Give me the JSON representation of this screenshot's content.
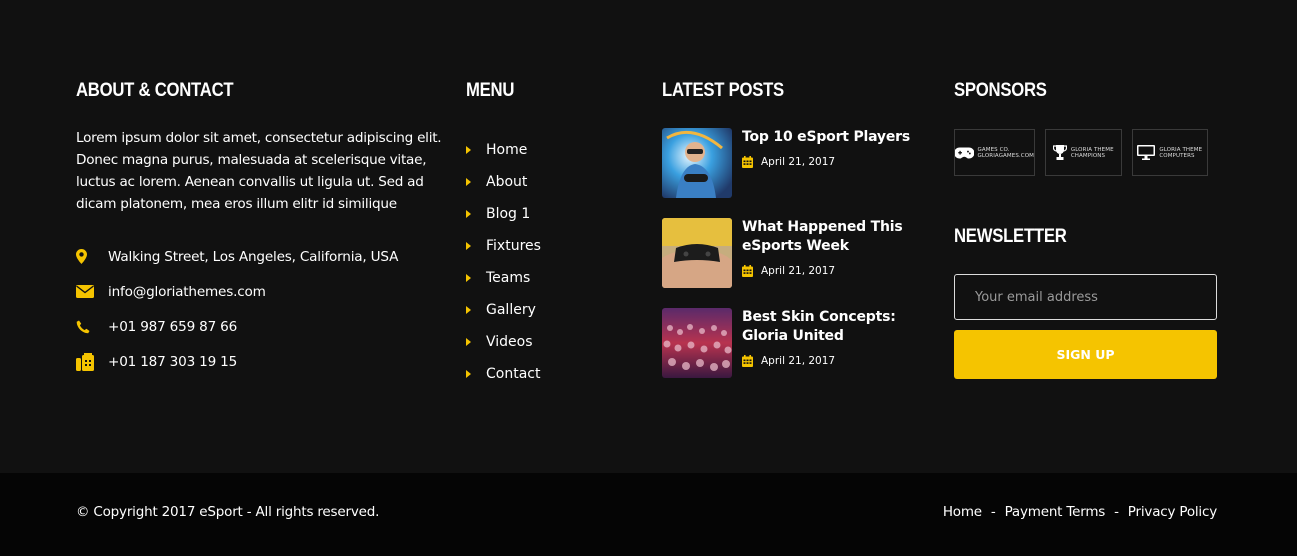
{
  "colors": {
    "accent": "#f5c400",
    "background": "#111111",
    "bottom_bar": "#050505"
  },
  "about": {
    "heading": "ABOUT & CONTACT",
    "text": "Lorem ipsum dolor sit amet, consectetur adipiscing elit. Donec magna purus, malesuada at scelerisque vitae, luctus ac lorem. Aenean convallis ut ligula ut. Sed ad dicam platonem, mea eros illum elitr id similique",
    "contacts": [
      {
        "icon": "map-pin-icon",
        "text": "Walking Street, Los Angeles, California, USA"
      },
      {
        "icon": "envelope-icon",
        "text": "info@gloriathemes.com"
      },
      {
        "icon": "phone-icon",
        "text": "+01 987 659 87 66"
      },
      {
        "icon": "fax-icon",
        "text": "+01 187 303 19 15"
      }
    ]
  },
  "menu": {
    "heading": "MENU",
    "items": [
      "Home",
      "About",
      "Blog 1",
      "Fixtures",
      "Teams",
      "Gallery",
      "Videos",
      "Contact"
    ]
  },
  "posts": {
    "heading": "LATEST POSTS",
    "items": [
      {
        "title": "Top 10 eSport Players",
        "date": "April 21, 2017"
      },
      {
        "title": "What Happened This eSports Week",
        "date": "April 21, 2017"
      },
      {
        "title": "Best Skin Concepts: Gloria United",
        "date": "April 21, 2017"
      }
    ]
  },
  "sponsors": {
    "heading": "SPONSORS",
    "items": [
      {
        "icon": "gamepad-icon",
        "line1": "GAMES CO.",
        "line2": "GLORIAGAMES.COM"
      },
      {
        "icon": "trophy-icon",
        "line1": "GLORIA THEME",
        "line2": "CHAMPIONS"
      },
      {
        "icon": "monitor-icon",
        "line1": "GLORIA THEME",
        "line2": "COMPUTERS"
      }
    ]
  },
  "newsletter": {
    "heading": "NEWSLETTER",
    "placeholder": "Your email address",
    "button": "SIGN UP"
  },
  "bottom": {
    "copyright": "© Copyright 2017 eSport - All rights reserved.",
    "links": [
      "Home",
      "Payment Terms",
      "Privacy Policy"
    ],
    "separator": "-"
  }
}
